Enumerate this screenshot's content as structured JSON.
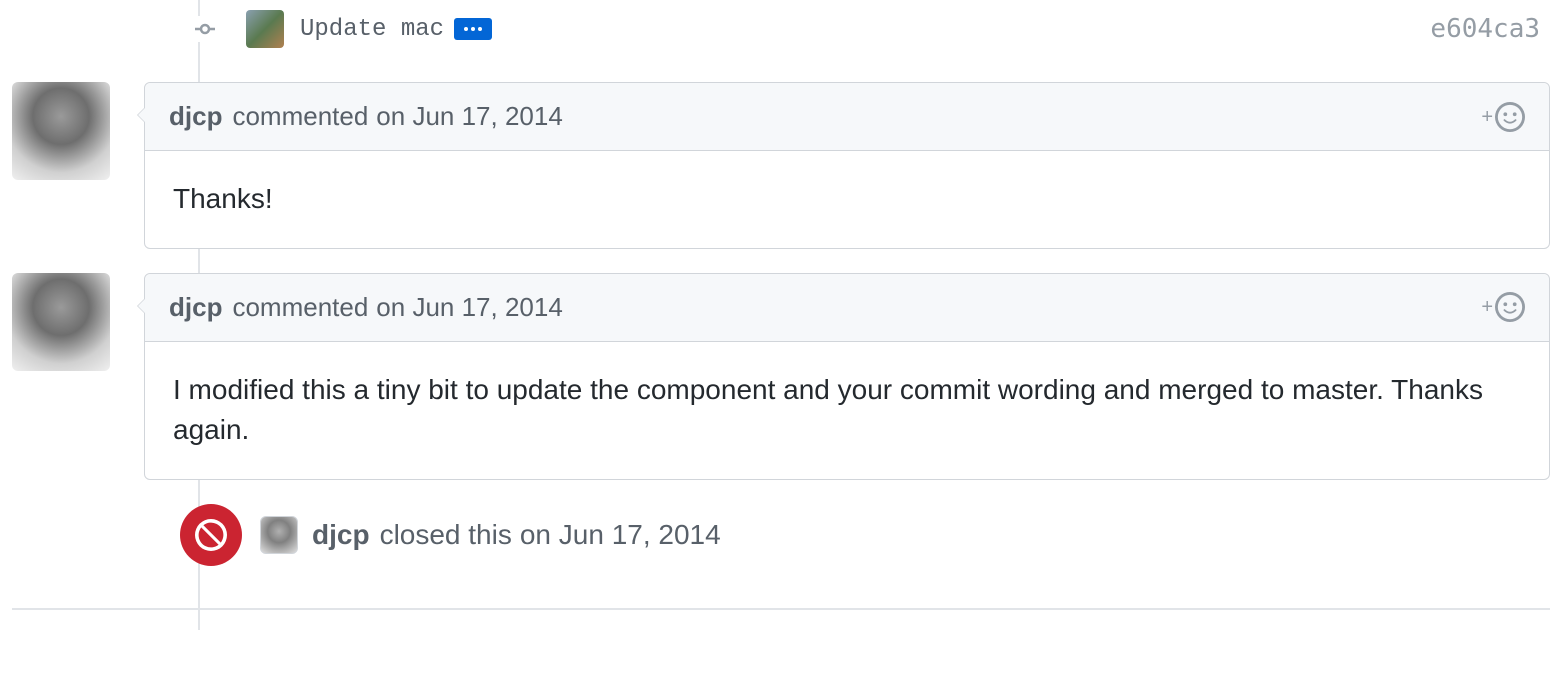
{
  "commit": {
    "title": "Update mac",
    "sha": "e604ca3"
  },
  "comments": [
    {
      "author": "djcp",
      "action": "commented",
      "date": "on Jun 17, 2014",
      "body": "Thanks!"
    },
    {
      "author": "djcp",
      "action": "commented",
      "date": "on Jun 17, 2014",
      "body": "I modified this a tiny bit to update the component and your commit wording and merged to master. Thanks again."
    }
  ],
  "closed_event": {
    "author": "djcp",
    "action": "closed this",
    "date": "on Jun 17, 2014"
  }
}
